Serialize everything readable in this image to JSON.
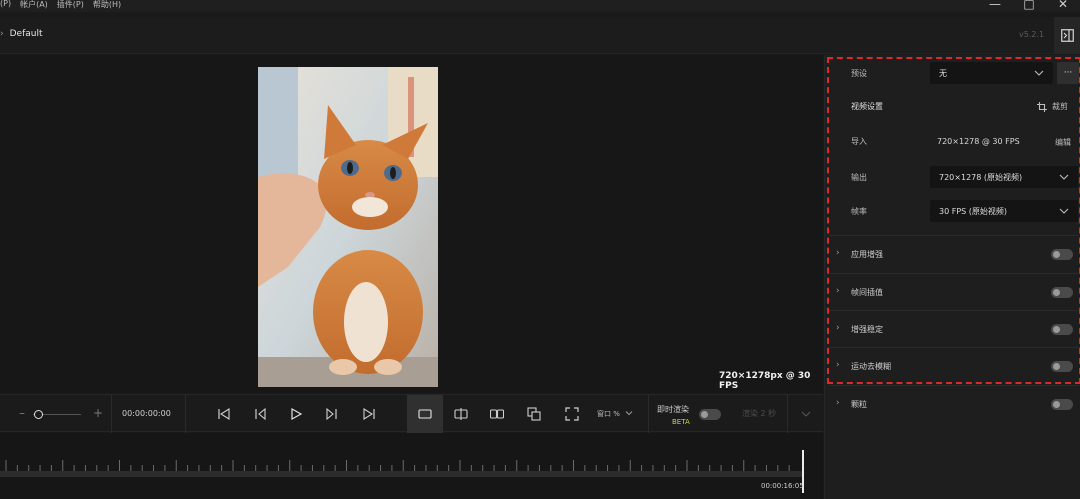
{
  "menu": {
    "items": [
      "(P)",
      "帐户(A)",
      "插件(P)",
      "帮助(H)"
    ]
  },
  "window_controls": {
    "minimize": "—",
    "maximize": "□",
    "close": "✕"
  },
  "titlebar": {
    "chevron": "›",
    "preset_name": "Default",
    "version": "v5.2.1"
  },
  "preview": {
    "resolution_label": "720×1278px @ 30 FPS"
  },
  "controls": {
    "zoom_minus": "–",
    "zoom_plus": "+",
    "zoom_level": 0.1,
    "timecode": "00:00:00:00",
    "window_percent": "窗口 %",
    "live_label": "即时渲染",
    "beta": "BETA",
    "render_label": "渲染 2 秒",
    "icons": [
      "skip-to-start-icon",
      "previous-frame-icon",
      "play-icon",
      "next-frame-icon",
      "skip-to-end-icon",
      "single-view-icon",
      "split-view-icon",
      "side-by-side-icon",
      "overlay-view-icon",
      "fullscreen-icon"
    ]
  },
  "timeline": {
    "end_time": "00:00:16:05"
  },
  "panel": {
    "preset_label": "预设",
    "preset_value": "无",
    "more": "···",
    "video_settings": "视频设置",
    "crop": "裁剪",
    "import_label": "导入",
    "import_value": "720×1278 @ 30 FPS",
    "edit": "编辑",
    "output_label": "输出",
    "output_value": "720×1278 (原始视频)",
    "fps_label": "帧率",
    "fps_value": "30 FPS (原始视频)",
    "features": [
      {
        "label": "应用增强"
      },
      {
        "label": "帧间插值"
      },
      {
        "label": "增强稳定"
      },
      {
        "label": "运动去模糊"
      },
      {
        "label": "颗粒"
      }
    ]
  },
  "colors": {
    "accent_dashed": "#d92b2b",
    "beta": "#b4d94a"
  }
}
